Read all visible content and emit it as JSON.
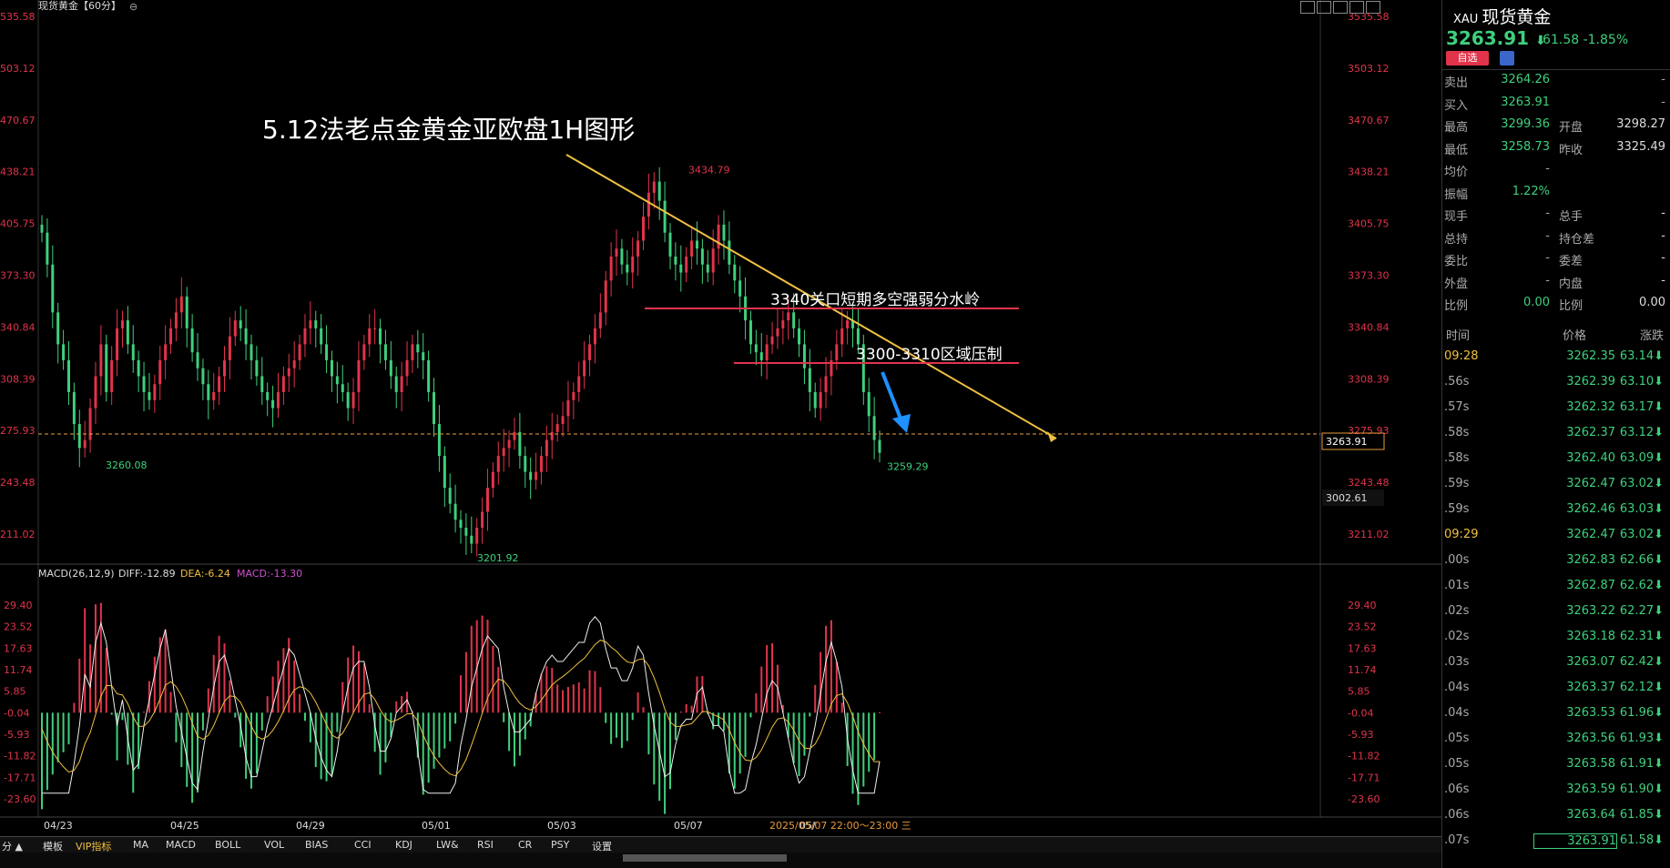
{
  "header": {
    "title": "现货黄金【60分】",
    "settings_icon": "gear-icon"
  },
  "annotation": {
    "title": "5.12法老点金黄金亚欧盘1H图形",
    "resistance_label": "3340关口短期多空强弱分水岭",
    "pressure_label": "3300-3310区域压制"
  },
  "chart_data": [
    {
      "type": "candlestick",
      "title": "现货黄金【60分】",
      "ylim": [
        3211.02,
        3535.58
      ],
      "y_ticks": [
        "3535.58",
        "3503.12",
        "3470.67",
        "3438.21",
        "3405.75",
        "3373.30",
        "3340.84",
        "3308.39",
        "3275.93",
        "3243.48",
        "3211.02"
      ],
      "x_ticks": [
        "04/23",
        "04/25",
        "04/29",
        "05/01",
        "05/03",
        "05/07"
      ],
      "points_labeled": [
        {
          "label": "3260.08",
          "x": "04/23",
          "y": 3260.08
        },
        {
          "label": "3201.92",
          "x": "05/01",
          "y": 3201.92
        },
        {
          "label": "3434.79",
          "x": "05/07",
          "y": 3434.79
        },
        {
          "label": "3259.29",
          "x": "05/08",
          "y": 3259.29
        }
      ],
      "close_series": [
        3400,
        3380,
        3350,
        3330,
        3320,
        3300,
        3280,
        3265,
        3270,
        3290,
        3310,
        3330,
        3300,
        3320,
        3340,
        3345,
        3330,
        3320,
        3310,
        3300,
        3295,
        3305,
        3320,
        3330,
        3340,
        3350,
        3360,
        3340,
        3325,
        3315,
        3305,
        3295,
        3300,
        3310,
        3320,
        3335,
        3345,
        3340,
        3330,
        3320,
        3310,
        3300,
        3295,
        3290,
        3300,
        3310,
        3315,
        3320,
        3330,
        3340,
        3345,
        3340,
        3330,
        3320,
        3310,
        3305,
        3300,
        3290,
        3300,
        3320,
        3330,
        3340,
        3340,
        3330,
        3320,
        3310,
        3300,
        3310,
        3320,
        3330,
        3325,
        3320,
        3300,
        3280,
        3260,
        3240,
        3230,
        3220,
        3215,
        3210,
        3205,
        3215,
        3225,
        3240,
        3250,
        3260,
        3265,
        3270,
        3275,
        3260,
        3250,
        3245,
        3250,
        3260,
        3270,
        3275,
        3280,
        3285,
        3295,
        3300,
        3310,
        3320,
        3330,
        3340,
        3350,
        3370,
        3385,
        3390,
        3380,
        3375,
        3385,
        3395,
        3410,
        3425,
        3432,
        3420,
        3400,
        3385,
        3380,
        3375,
        3385,
        3395,
        3390,
        3380,
        3375,
        3390,
        3405,
        3395,
        3380,
        3370,
        3360,
        3345,
        3330,
        3325,
        3320,
        3330,
        3335,
        3340,
        3345,
        3350,
        3340,
        3330,
        3315,
        3300,
        3290,
        3300,
        3310,
        3320,
        3330,
        3340,
        3345,
        3340,
        3330,
        3300,
        3285,
        3270,
        3262
      ],
      "current_price": "3263.91",
      "secondary_label": "3002.61",
      "time_label": "2025/05/07 22:00～23:00 三",
      "x_tick_partial": "05/",
      "y_axis_left_labels": [
        "535.58",
        "503.12",
        "470.67",
        "438.21",
        "405.75",
        "373.30",
        "340.84",
        "308.39",
        "275.93",
        "243.48",
        "211.02"
      ]
    },
    {
      "type": "bar",
      "title": "MACD(26,12,9)",
      "legend": {
        "diff": "DIFF:-12.89",
        "dea": "DEA:-6.24",
        "macd": "MACD:-13.30"
      },
      "ylim": [
        -23.6,
        29.4
      ],
      "y_ticks": [
        "29.40",
        "23.52",
        "17.63",
        "11.74",
        "5.85",
        "-0.04",
        "-5.93",
        "-11.82",
        "-17.71",
        "-23.60"
      ]
    }
  ],
  "sidebar": {
    "symbol": "XAU",
    "name": "现货黄金",
    "price": "3263.91",
    "change": "-61.58",
    "change_pct": "-1.85%",
    "watch_label": "自选",
    "quote_rows": [
      {
        "l1": "卖出",
        "v1": "3264.26",
        "l2": "",
        "v2": "-"
      },
      {
        "l1": "买入",
        "v1": "3263.91",
        "l2": "",
        "v2": "-"
      },
      {
        "l1": "最高",
        "v1": "3299.36",
        "l2": "开盘",
        "v2": "3298.27"
      },
      {
        "l1": "最低",
        "v1": "3258.73",
        "l2": "昨收",
        "v2": "3325.49"
      },
      {
        "l1": "均价",
        "v1": "-",
        "l2": "",
        "v2": ""
      },
      {
        "l1": "振幅",
        "v1": "1.22%",
        "l2": "",
        "v2": ""
      },
      {
        "l1": "现手",
        "v1": "-",
        "l2": "总手",
        "v2": "-"
      },
      {
        "l1": "总持",
        "v1": "-",
        "l2": "持仓差",
        "v2": "-"
      },
      {
        "l1": "委比",
        "v1": "-",
        "l2": "委差",
        "v2": "-"
      },
      {
        "l1": "外盘",
        "v1": "-",
        "l2": "内盘",
        "v2": "-"
      },
      {
        "l1": "比例",
        "v1": "0.00",
        "l2": "比例",
        "v2": "0.00"
      }
    ],
    "tick_headers": {
      "time": "时间",
      "price": "价格",
      "change": "涨跌"
    },
    "ticks": [
      {
        "t": "09:28",
        "p": "3262.35",
        "v": "63.14"
      },
      {
        "t": ".56s",
        "p": "3262.39",
        "v": "63.10"
      },
      {
        "t": ".57s",
        "p": "3262.32",
        "v": "63.17"
      },
      {
        "t": ".58s",
        "p": "3262.37",
        "v": "63.12"
      },
      {
        "t": ".58s",
        "p": "3262.40",
        "v": "63.09"
      },
      {
        "t": ".59s",
        "p": "3262.47",
        "v": "63.02"
      },
      {
        "t": ".59s",
        "p": "3262.46",
        "v": "63.03"
      },
      {
        "t": "09:29",
        "p": "3262.47",
        "v": "63.02"
      },
      {
        "t": ".00s",
        "p": "3262.83",
        "v": "62.66"
      },
      {
        "t": ".01s",
        "p": "3262.87",
        "v": "62.62"
      },
      {
        "t": ".02s",
        "p": "3263.22",
        "v": "62.27"
      },
      {
        "t": ".02s",
        "p": "3263.18",
        "v": "62.31"
      },
      {
        "t": ".03s",
        "p": "3263.07",
        "v": "62.42"
      },
      {
        "t": ".04s",
        "p": "3263.37",
        "v": "62.12"
      },
      {
        "t": ".04s",
        "p": "3263.53",
        "v": "61.96"
      },
      {
        "t": ".05s",
        "p": "3263.56",
        "v": "61.93"
      },
      {
        "t": ".05s",
        "p": "3263.58",
        "v": "61.91"
      },
      {
        "t": ".06s",
        "p": "3263.59",
        "v": "61.90"
      },
      {
        "t": ".06s",
        "p": "3263.64",
        "v": "61.85"
      },
      {
        "t": ".07s",
        "p": "3263.91",
        "v": "61.58"
      }
    ]
  },
  "bottom_bar": {
    "items": [
      "分 ▲",
      "模板",
      "VIP指标",
      "MA",
      "MACD",
      "BOLL",
      "VOL",
      "BIAS",
      "CCI",
      "KDJ",
      "LW&",
      "RSI",
      "CR",
      "PSY",
      "设置"
    ]
  },
  "colors": {
    "up": "#e1344b",
    "down": "#3ed07c",
    "ma": "#f0c040",
    "arrow": "#1e90ff"
  }
}
